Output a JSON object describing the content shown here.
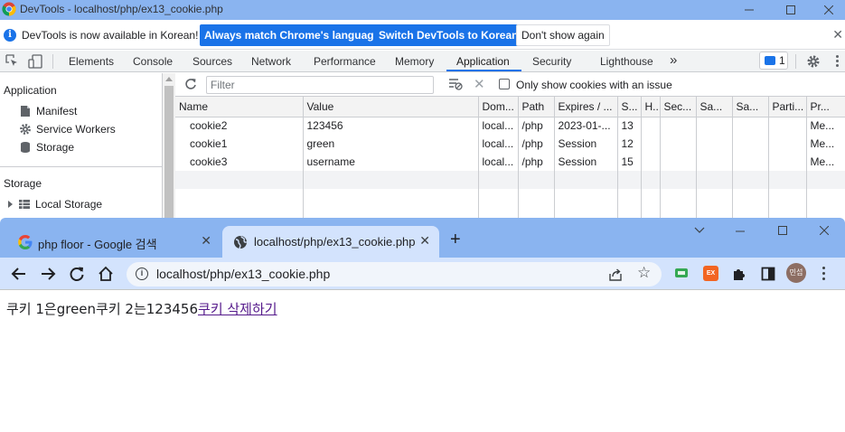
{
  "devtools": {
    "window_title": "DevTools - localhost/php/ex13_cookie.php",
    "infobar": {
      "message": "DevTools is now available in Korean!",
      "btn_match": "Always match Chrome's language",
      "btn_switch": "Switch DevTools to Korean",
      "btn_dismiss": "Don't show again"
    },
    "tabs": [
      "Elements",
      "Console",
      "Sources",
      "Network",
      "Performance",
      "Memory",
      "Application",
      "Security",
      "Lighthouse"
    ],
    "active_tab": "Application",
    "more_tabs": "»",
    "message_count": "1",
    "sidebar": {
      "application_header": "Application",
      "items": [
        "Manifest",
        "Service Workers",
        "Storage"
      ],
      "storage_header": "Storage",
      "storage_items": [
        "Local Storage"
      ]
    },
    "filter": {
      "placeholder": "Filter",
      "checkbox_label": "Only show cookies with an issue",
      "checked": false
    },
    "cookie_table": {
      "columns": [
        "Name",
        "Value",
        "Dom...",
        "Path",
        "Expires / ...",
        "S...",
        "H..",
        "Sec...",
        "Sa...",
        "Sa...",
        "Parti...",
        "Pr..."
      ],
      "rows": [
        [
          "cookie2",
          "123456",
          "local...",
          "/php",
          "2023-01-...",
          "13",
          "",
          "",
          "",
          "",
          "",
          "Me..."
        ],
        [
          "cookie1",
          "green",
          "local...",
          "/php",
          "Session",
          "12",
          "",
          "",
          "",
          "",
          "",
          "Me..."
        ],
        [
          "cookie3",
          "username",
          "local...",
          "/php",
          "Session",
          "15",
          "",
          "",
          "",
          "",
          "",
          "Me..."
        ]
      ]
    }
  },
  "browser": {
    "tabs": [
      {
        "title": "php floor - Google 검색",
        "active": false
      },
      {
        "title": "localhost/php/ex13_cookie.php",
        "active": true
      }
    ],
    "new_tab_label": "+",
    "url": "localhost/php/ex13_cookie.php",
    "profile_label": "민섭",
    "ext_badge": "EX",
    "page": {
      "text": "쿠키 1은green쿠키 2는123456",
      "link_text": "쿠키 삭제하기"
    }
  },
  "colors": {
    "titlebar": "#8ab4f0",
    "accent": "#1a73e8",
    "toolbar": "#d3e3fd",
    "visited_link": "#551a8b"
  }
}
